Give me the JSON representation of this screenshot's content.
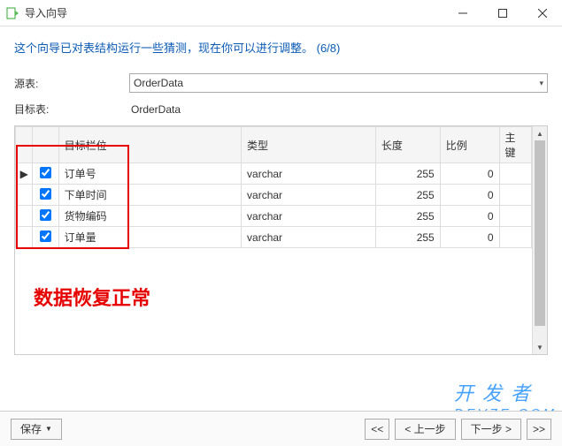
{
  "titlebar": {
    "title": "导入向导"
  },
  "intro": "这个向导已对表结构运行一些猜测，现在你可以进行调整。 (6/8)",
  "form": {
    "sourceLabel": "源表:",
    "sourceValue": "OrderData",
    "targetLabel": "目标表:",
    "targetValue": "OrderData"
  },
  "grid": {
    "headers": {
      "target": "目标栏位",
      "type": "类型",
      "length": "长度",
      "scale": "比例",
      "pk": "主键"
    },
    "rows": [
      {
        "marker": "▶",
        "checked": true,
        "target": "订单号",
        "type": "varchar",
        "length": "255",
        "scale": "0"
      },
      {
        "marker": "",
        "checked": true,
        "target": "下单时间",
        "type": "varchar",
        "length": "255",
        "scale": "0"
      },
      {
        "marker": "",
        "checked": true,
        "target": "货物编码",
        "type": "varchar",
        "length": "255",
        "scale": "0"
      },
      {
        "marker": "",
        "checked": true,
        "target": "订单量",
        "type": "varchar",
        "length": "255",
        "scale": "0"
      }
    ]
  },
  "annotation": "数据恢复正常",
  "footer": {
    "save": "保存",
    "first": "<<",
    "prev": "< 上一步",
    "next": "下一步 >",
    "last": ">>"
  },
  "watermark": {
    "line1": "开 发 者",
    "line2": "DEVZE.COM"
  }
}
